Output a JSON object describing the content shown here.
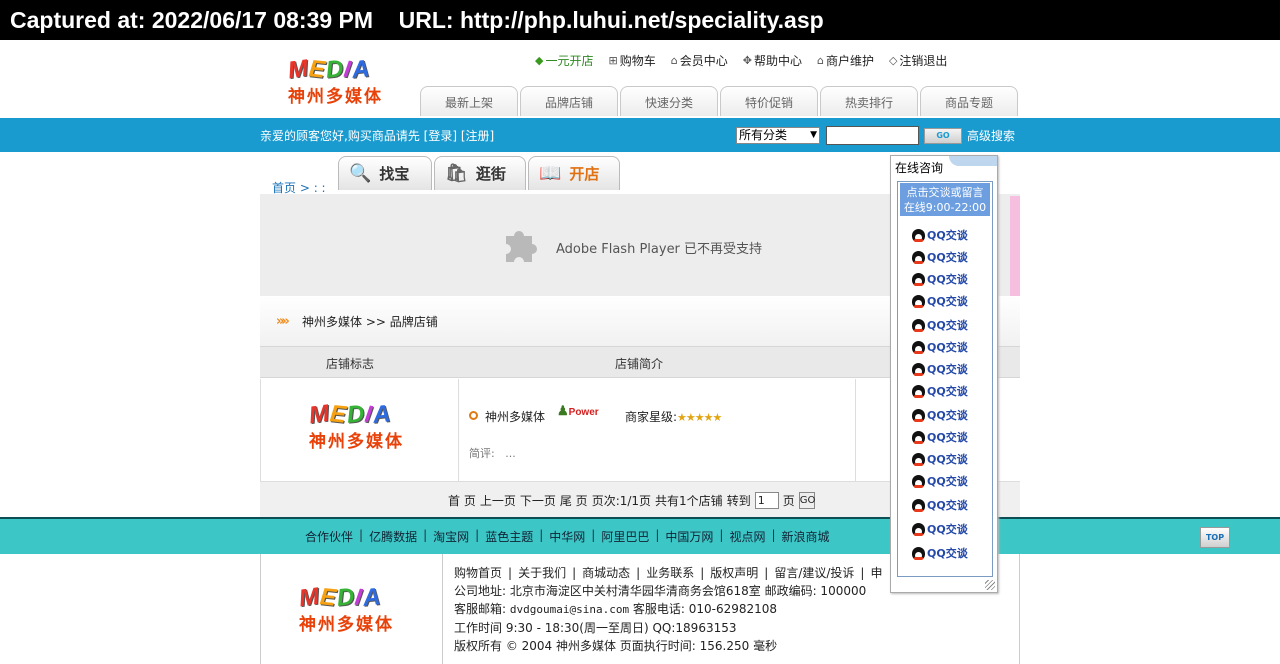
{
  "capture": {
    "text": "Captured at: 2022/06/17 08:39 PM    URL: http://php.luhui.net/speciality.asp"
  },
  "logo": {
    "letters": [
      "M",
      "E",
      "D",
      "I",
      "A"
    ],
    "cn": "神州多媒体"
  },
  "toplinks": [
    {
      "icon": "dollar-icon",
      "label": "一元开店"
    },
    {
      "icon": "cart-icon",
      "label": "购物车"
    },
    {
      "icon": "home-icon",
      "label": "会员中心"
    },
    {
      "icon": "help-icon",
      "label": "帮助中心"
    },
    {
      "icon": "home-icon",
      "label": "商户维护"
    },
    {
      "icon": "logout-icon",
      "label": "注销退出"
    }
  ],
  "navtabs": [
    "最新上架",
    "品牌店铺",
    "快速分类",
    "特价促销",
    "热卖排行",
    "商品专题"
  ],
  "searchbar": {
    "welcome_prefix": "亲爱的顾客您好,购买商品请先 [",
    "login": "登录",
    "mid": "] [",
    "register": "注册",
    "suffix": "]",
    "category": "所有分类",
    "go": "GO",
    "advanced": "高级搜索"
  },
  "breadcrumb": {
    "home": "首页",
    "sep": " > : :"
  },
  "subtabs": [
    {
      "icon": "magnifier-icon",
      "label": "找宝"
    },
    {
      "icon": "shopping-bag-icon",
      "label": "逛街"
    },
    {
      "icon": "book-icon",
      "label": "开店"
    }
  ],
  "flash": {
    "message": "Adobe Flash Player 已不再受支持"
  },
  "store_section": {
    "path": "神州多媒体 >> 品牌店铺",
    "columns": [
      "店铺标志",
      "店铺简介"
    ],
    "store": {
      "name": "神州多媒体",
      "badge": "Power",
      "rating_label": "商家星级:",
      "stars": "★★★★★",
      "review_label": "简评:",
      "review_text": "..."
    }
  },
  "pager": {
    "first": "首 页",
    "prev": "上一页",
    "next": "下一页",
    "last": "尾 页",
    "pages": "页次:1/1页",
    "count": "共有1个店铺",
    "goto_label": "转到",
    "page_value": "1",
    "page_unit": "页",
    "go": "GO"
  },
  "partners": [
    "合作伙伴",
    "亿腾数据",
    "淘宝网",
    "蓝色主题",
    "中华网",
    "阿里巴巴",
    "中国万网",
    "视点网",
    "新浪商城"
  ],
  "top_button": "TOP",
  "footer": {
    "links": [
      "购物首页",
      "关于我们",
      "商城动态",
      "业务联系",
      "版权声明",
      "留言/建议/投诉",
      "申"
    ],
    "address": "公司地址: 北京市海淀区中关村清华园华清商务会馆618室  邮政编码: 100000",
    "email_label": "客服邮箱: ",
    "email": "dvdgoumai@sina.com",
    "phone": "  客服电话: 010-62982108",
    "hours": "工作时间 9:30 - 18:30(周一至周日)  QQ:18963153",
    "copyright": "版权所有 © 2004 神州多媒体  页面执行时间: 156.250 毫秒"
  },
  "consult": {
    "title": "在线咨询",
    "notice_line1": "点击交谈或留言",
    "notice_line2": "在线9:00-22:00",
    "qq_label": "QQ交谈",
    "qq_count": 15
  }
}
